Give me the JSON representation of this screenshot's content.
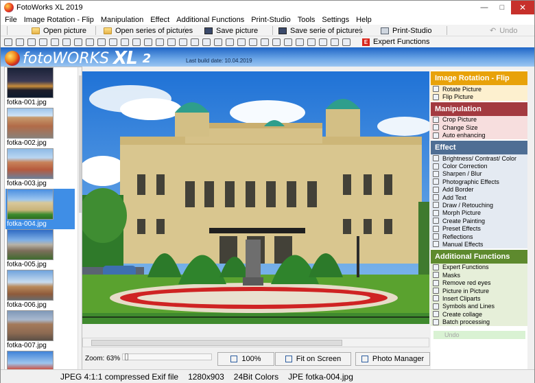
{
  "window": {
    "title": "FotoWorks XL 2019",
    "minimize": "—",
    "maximize": "□",
    "close": "✕"
  },
  "menu": [
    "File",
    "Image Rotation - Flip",
    "Manipulation",
    "Effect",
    "Additional Functions",
    "Print-Studio",
    "Tools",
    "Settings",
    "Help"
  ],
  "toolbar": {
    "open_picture": "Open picture",
    "open_series": "Open series of pictures",
    "save_picture": "Save picture",
    "save_series": "Save serie of pictures",
    "print_studio": "Print-Studio",
    "undo": "Undo",
    "expert_functions": "Expert Functions"
  },
  "banner": {
    "logo_text": "fotoWORKS",
    "logo_xl": "XL",
    "logo_num": "2",
    "build": "Last build date:  10.04.2019"
  },
  "thumbnails": [
    {
      "caption": "fotka-001.jpg",
      "selected": false
    },
    {
      "caption": "fotka-002.jpg",
      "selected": false
    },
    {
      "caption": "fotka-003.jpg",
      "selected": false
    },
    {
      "caption": "fotka-004.jpg",
      "selected": true
    },
    {
      "caption": "fotka-005.jpg",
      "selected": false
    },
    {
      "caption": "fotka-006.jpg",
      "selected": false
    },
    {
      "caption": "fotka-007.jpg",
      "selected": false
    },
    {
      "caption": "",
      "selected": false
    }
  ],
  "viewer": {
    "zoom_label": "Zoom: 63%",
    "zoom_percent": 63,
    "btn_100": "100%",
    "btn_fit": "Fit on Screen",
    "btn_photo_manager": "Photo Manager"
  },
  "panel": {
    "sections": [
      {
        "title": "Image Rotation - Flip",
        "color": "#e8a20a",
        "itembg": "#fdf0cf",
        "items": [
          "Rotate Picture",
          "Flip Picture"
        ]
      },
      {
        "title": "Manipulation",
        "color": "#a33a40",
        "itembg": "#f7dede",
        "items": [
          "Crop Picture",
          "Change Size",
          "Auto enhancing"
        ]
      },
      {
        "title": "Effect",
        "color": "#4f6e94",
        "itembg": "#e4eaf2",
        "items": [
          "Brightness/ Contrast/ Color",
          "Color Correction",
          "Sharpen / Blur",
          "Photographic Effects",
          "Add Border",
          "Add Text",
          "Draw / Retouching",
          "Morph Picture",
          "Create Painting",
          "Preset Effects",
          "Reflections",
          "Manual Effects"
        ]
      },
      {
        "title": "Additional Functions",
        "color": "#5e8a2e",
        "itembg": "#e6efd9",
        "items": [
          "Expert Functions",
          "Masks",
          "Remove red eyes",
          "Picture in Picture",
          "Insert Cliparts",
          "Symbols and Lines",
          "Create collage",
          "Batch processing"
        ]
      }
    ],
    "undo": "Undo"
  },
  "status": {
    "format": "JPEG 4:1:1 compressed Exif file",
    "size": "1280x903",
    "colors": "24Bit Colors",
    "file": "JPE fotka-004.jpg"
  }
}
